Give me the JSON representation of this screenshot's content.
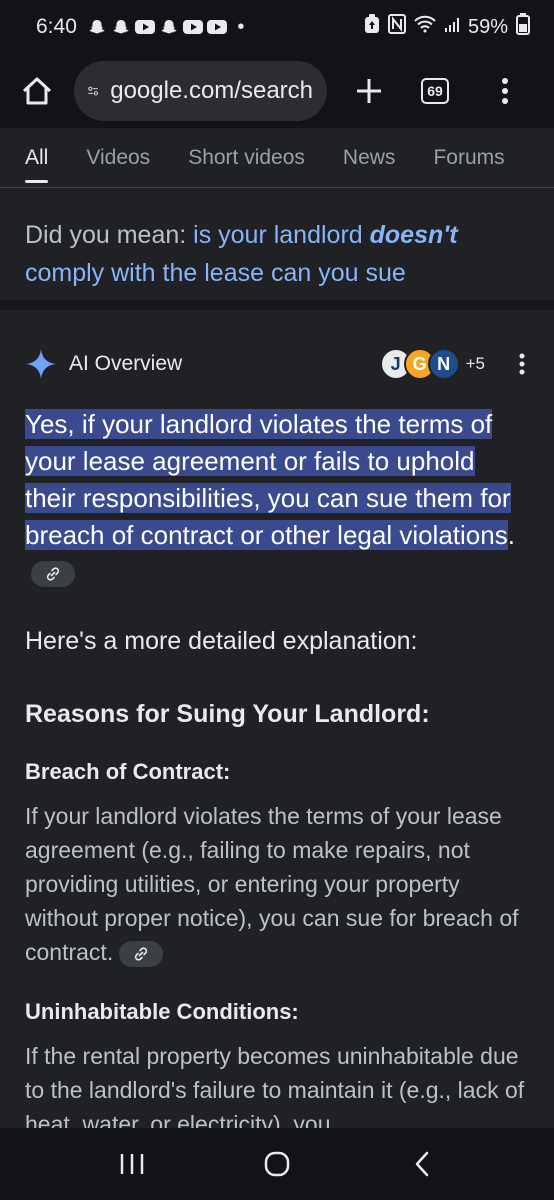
{
  "status_bar": {
    "time": "6:40",
    "notification_icons": [
      "snapchat-icon",
      "snapchat-icon",
      "youtube-icon",
      "snapchat-icon",
      "youtube-icon",
      "youtube-icon"
    ],
    "dot": "•",
    "battery": "59%"
  },
  "browser": {
    "url": "google.com/search",
    "tab_count": "69"
  },
  "filter_tabs": [
    "All",
    "Videos",
    "Short videos",
    "News",
    "Forums"
  ],
  "did_you_mean": {
    "prefix": "Did you mean: ",
    "part1": "is your landlord ",
    "emphasis": "doesn't",
    "part2": " comply with the lease can you sue"
  },
  "ai_overview": {
    "title": "AI Overview",
    "source_letters": [
      "J",
      "G",
      "N"
    ],
    "source_more": "+5",
    "summary": "Yes, if your landlord violates the terms of your lease agreement or fails to uphold their responsibilities, you can sue them for breach of contract or other legal violations",
    "summary_end": ".",
    "intro": "Here's a more detailed explanation:",
    "heading": "Reasons for Suing Your Landlord:",
    "sections": [
      {
        "title": "Breach of Contract:",
        "body": "If your landlord violates the terms of your lease agreement (e.g., failing to make repairs, not providing utilities, or entering your property without proper notice), you can sue for breach of contract."
      },
      {
        "title": "Uninhabitable Conditions:",
        "body": "If the rental property becomes uninhabitable due to the landlord's failure to maintain it (e.g., lack of heat, water, or electricity), you"
      }
    ]
  },
  "colors": {
    "background": "#202124",
    "link": "#8ab4f8",
    "highlight": "#3b4a8f"
  }
}
